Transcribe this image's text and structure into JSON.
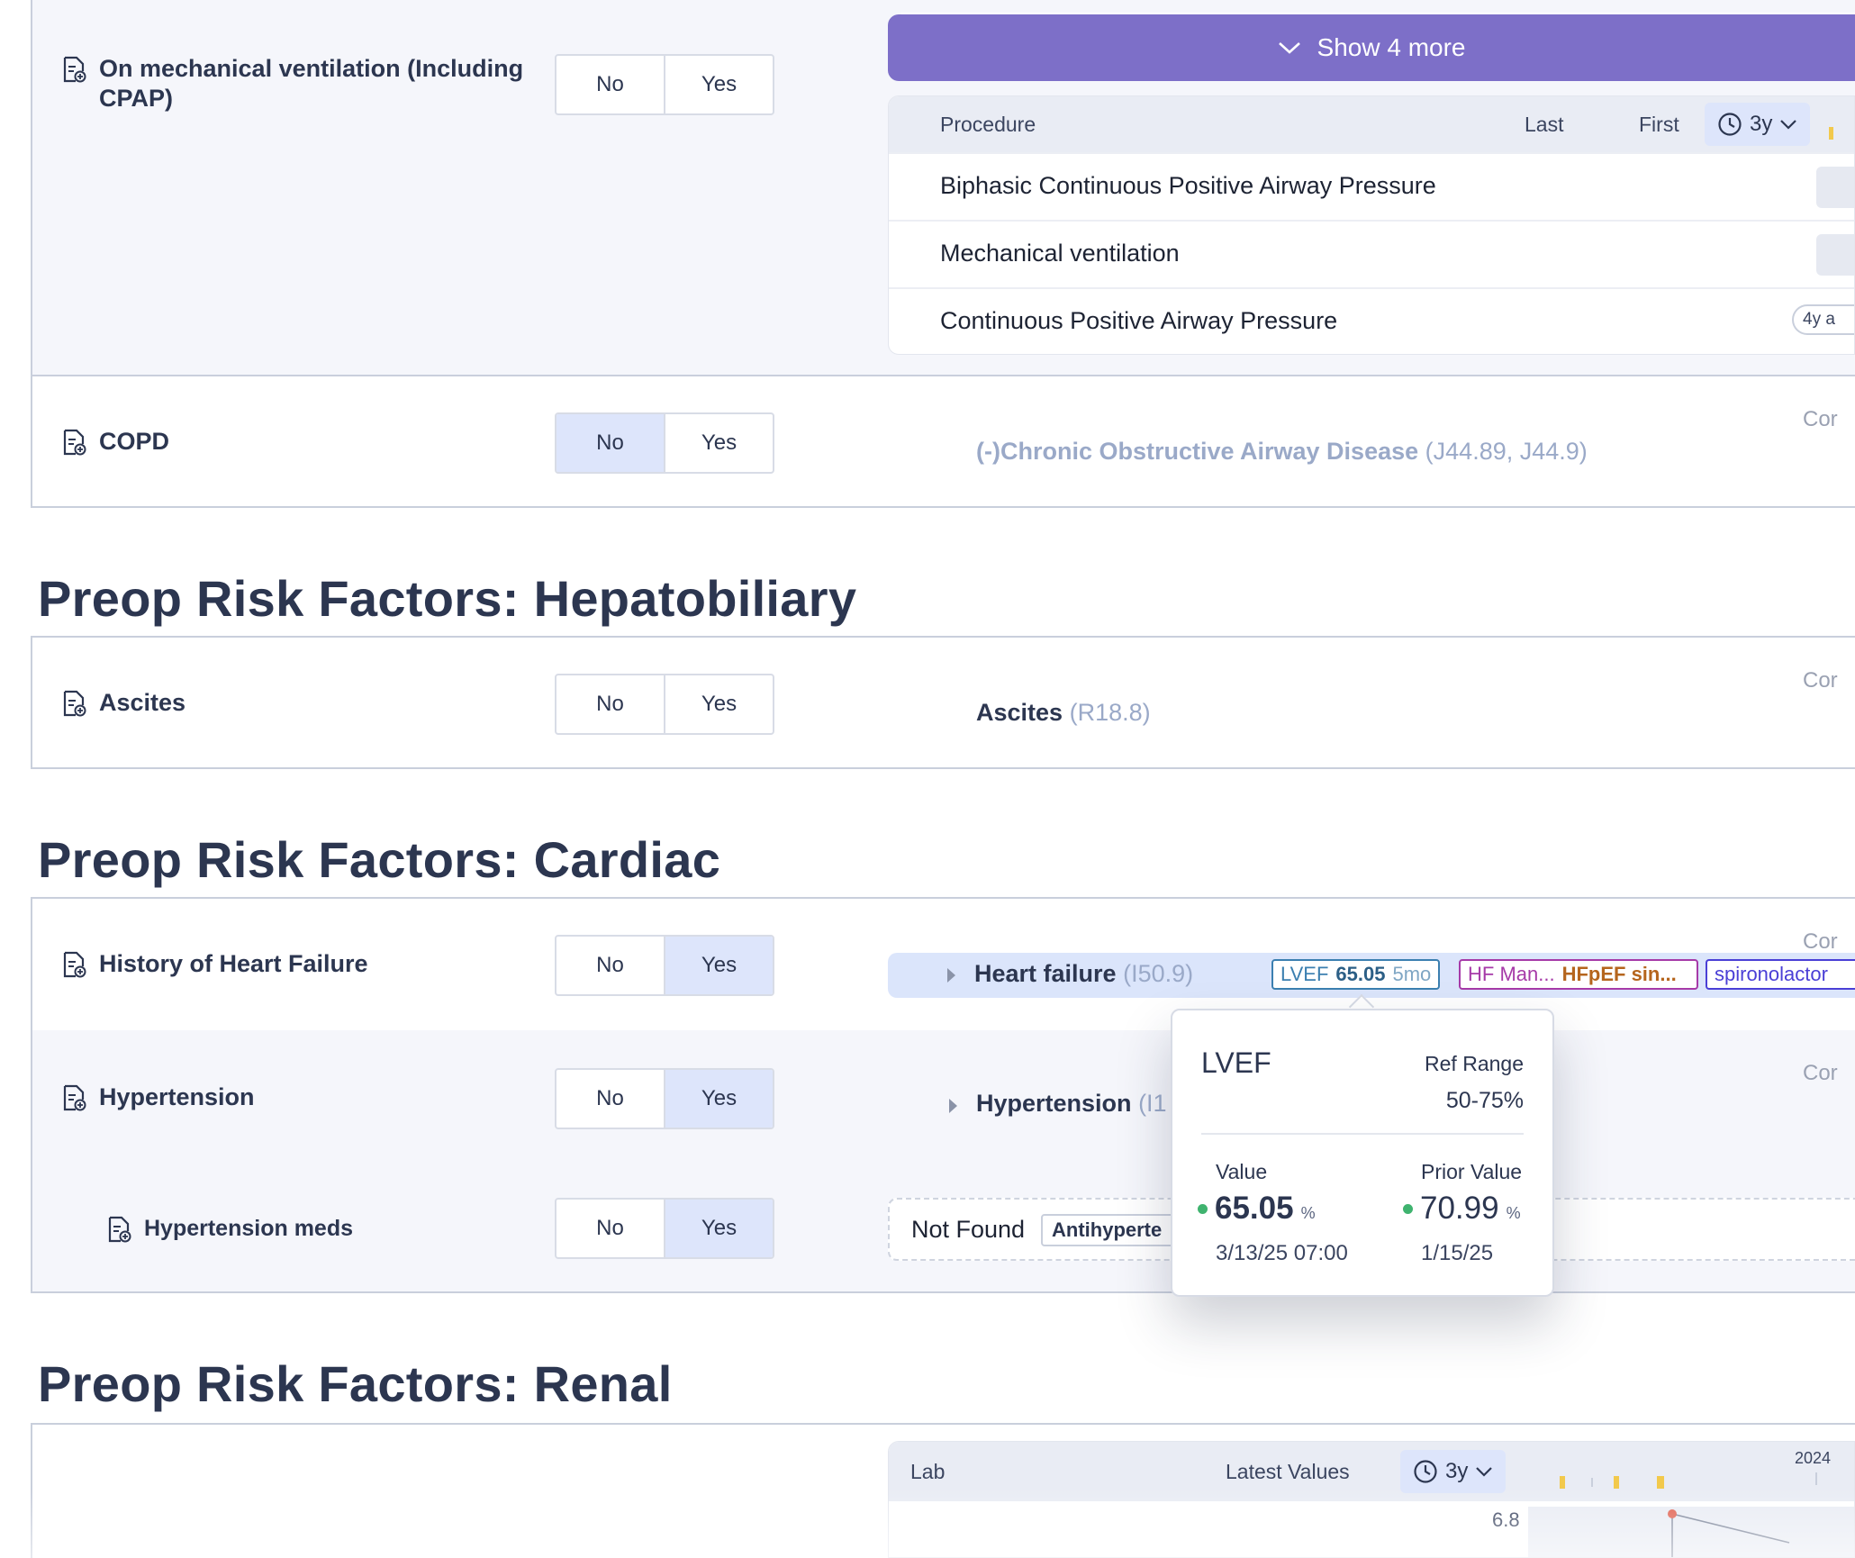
{
  "toggle_labels": {
    "no": "No",
    "yes": "Yes"
  },
  "column_con_label": "Cor",
  "respiratory": {
    "mech_vent": {
      "label": "On mechanical ventilation (Including CPAP)",
      "selected": null
    },
    "show_more": "Show 4 more",
    "procedure_table": {
      "headers": {
        "procedure": "Procedure",
        "last": "Last",
        "first": "First",
        "range": "3y"
      },
      "rows": [
        {
          "name": "Biphasic Continuous Positive Airway Pressure",
          "chip": ""
        },
        {
          "name": "Mechanical ventilation",
          "chip": ""
        },
        {
          "name": "Continuous Positive Airway Pressure",
          "chip": "4y a"
        }
      ]
    },
    "copd": {
      "label": "COPD",
      "selected": "No",
      "dx_name": "(-)Chronic Obstructive Airway Disease",
      "dx_codes": "(J44.89, J44.9)"
    }
  },
  "hepatobiliary": {
    "title": "Preop Risk Factors: Hepatobiliary",
    "ascites": {
      "label": "Ascites",
      "selected": null,
      "dx_name": "Ascites",
      "dx_codes": "(R18.8)"
    }
  },
  "cardiac": {
    "title": "Preop Risk Factors: Cardiac",
    "heart_failure": {
      "label": "History of Heart Failure",
      "selected": "Yes",
      "dx_name": "Heart failure",
      "dx_codes": "(I50.9)",
      "tags": {
        "lvef": {
          "name": "LVEF",
          "value": "65.05",
          "age": "5mo"
        },
        "hf_management": {
          "part1": "HF Man...",
          "part2": "HFpEF sin..."
        },
        "med": "spironolactor"
      }
    },
    "hypertension": {
      "label": "Hypertension",
      "selected": "Yes",
      "dx_name": "Hypertension",
      "dx_codes": "(I1"
    },
    "hypertension_meds": {
      "label": "Hypertension meds",
      "selected": "Yes",
      "not_found": "Not Found",
      "chip": "Antihyperte"
    }
  },
  "lvef_tooltip": {
    "title": "LVEF",
    "ref_range_label": "Ref Range",
    "ref_range": "50-75%",
    "value_label": "Value",
    "value": "65.05",
    "value_unit": "%",
    "value_date": "3/13/25 07:00",
    "prior_label": "Prior Value",
    "prior_value": "70.99",
    "prior_unit": "%",
    "prior_date": "1/15/25",
    "status_color": "#3fb36f"
  },
  "renal": {
    "title": "Preop Risk Factors: Renal",
    "lab_table": {
      "headers": {
        "lab": "Lab",
        "latest": "Latest Values",
        "range": "3y"
      },
      "year_tick": "2024",
      "first_value": "6.8"
    }
  },
  "colors": {
    "accent_purple": "#7d6fc8",
    "selected_toggle": "#dde5fb",
    "heading": "#2c3650",
    "lvef_tag": "#3b7fb0",
    "hf_tag": "#a63aa8",
    "hf_tag_secondary": "#b5651d",
    "med_tag": "#4a3fd6"
  }
}
